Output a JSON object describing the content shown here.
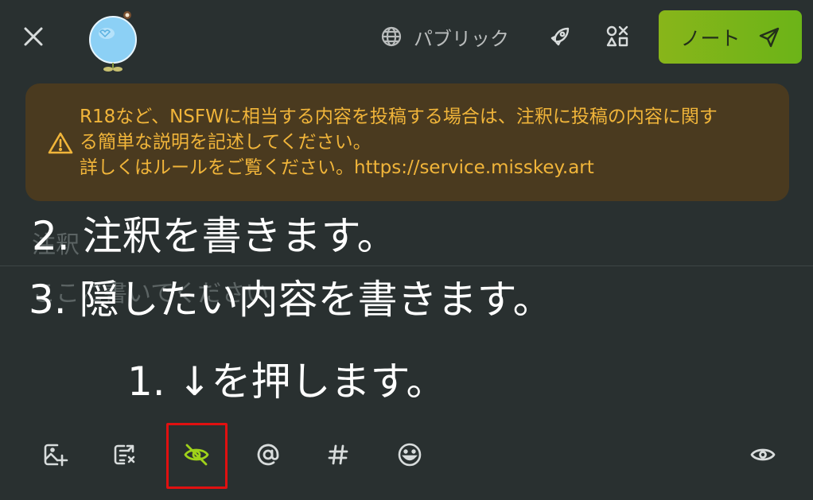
{
  "header": {
    "visibility_label": "パブリック",
    "post_label": "ノート"
  },
  "warning": {
    "line1": "R18など、NSFWに相当する内容を投稿する場合は、注釈に投稿の内容に関す",
    "line2": "る簡単な説明を記述してください。",
    "line3": "詳しくはルールをご覧ください。https://service.misskey.art"
  },
  "editor": {
    "cw_placeholder": "注釈",
    "text_placeholder": "ここに書いてください"
  },
  "annotations": {
    "step2": "2. 注釈を書きます。",
    "step3": "3. 隠したい内容を書きます。",
    "step1": "1. ↓を押します。"
  },
  "colors": {
    "background": "#293030",
    "accent_green": "#86b300",
    "warning_bg": "#4a3a1f",
    "warning_text": "#f1b53a",
    "highlight_border": "#e01010"
  },
  "icons": {
    "close": "close-icon",
    "globe": "globe-icon",
    "rocket": "rocket-icon",
    "shapes": "shapes-icon",
    "send": "send-icon",
    "warning": "warning-triangle-icon",
    "image_add": "image-add-icon",
    "poll": "poll-icon",
    "hide": "eye-off-icon",
    "mention": "at-icon",
    "hashtag": "hashtag-icon",
    "emoji": "emoji-icon",
    "preview": "eye-icon"
  }
}
